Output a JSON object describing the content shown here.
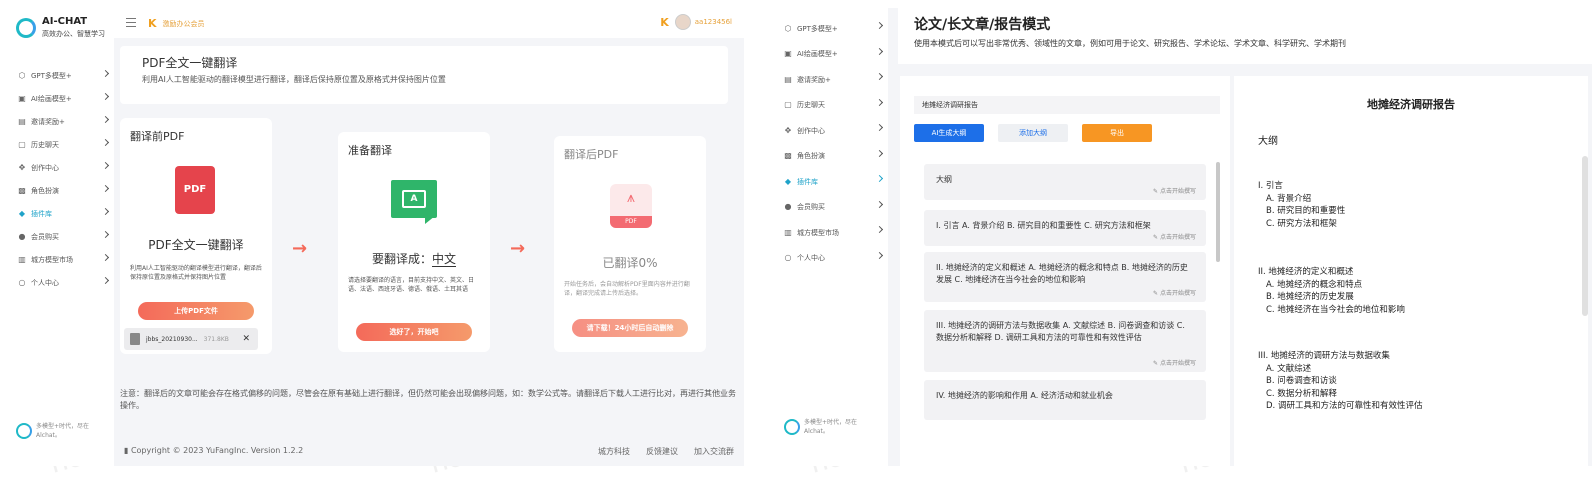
{
  "left_app": {
    "brand": {
      "name": "AI-CHAT",
      "slogan": "高效办公、智慧学习"
    },
    "menu": [
      {
        "icon": "gpt-icon",
        "label": "GPT多模型+"
      },
      {
        "icon": "image-icon",
        "label": "AI绘画模型+"
      },
      {
        "icon": "gift-icon",
        "label": "邀请奖励+"
      },
      {
        "icon": "history-icon",
        "label": "历史聊天"
      },
      {
        "icon": "create-icon",
        "label": "创作中心"
      },
      {
        "icon": "role-icon",
        "label": "角色扮演"
      },
      {
        "icon": "plugin-icon",
        "label": "插件库",
        "active": true
      },
      {
        "icon": "member-icon",
        "label": "会员购买"
      },
      {
        "icon": "market-icon",
        "label": "城方模型市场"
      },
      {
        "icon": "user-icon",
        "label": "个人中心"
      }
    ],
    "sidebar_footer": "多模型+时代，尽在Alchat。",
    "topbar": {
      "vip_text": "激励办公会员",
      "username": "aa123456l"
    },
    "header": {
      "title": "PDF全文一键翻译",
      "subtitle": "利用AI人工智能驱动的翻译模型进行翻译，翻译后保持原位置及原格式并保持图片位置"
    },
    "card_before": {
      "title": "翻译前PDF",
      "icon_text": "PDF",
      "big": "PDF全文一键翻译",
      "desc": "利用AI人工智能驱动的翻译模型进行翻译，翻译后保持原位置及原格式并保持图片位置",
      "button": "上传PDF文件",
      "file_name": "jbbs_20210930...",
      "file_size": "371.8KB"
    },
    "card_ready": {
      "title": "准备翻译",
      "icon_text": "A",
      "big_prefix": "要翻译成：",
      "big_lang": "中文",
      "desc": "请选择要翻译的语言，目前支持中文、英文、日语、法语、西班牙语、德语、俄语、土耳其语",
      "button": "选好了，开始吧"
    },
    "card_after": {
      "title": "翻译后PDF",
      "icon_text": "PDF",
      "big": "已翻译0%",
      "desc": "开始任务后，会自动解析PDF里面内容并进行翻译，翻译完成请上传后选择。",
      "button": "请下载！24小时后自动删除"
    },
    "note": "注意：翻译后的文章可能会存在格式偏移的问题，尽管会在原有基础上进行翻译，但仍然可能会出现偏移问题，如：数学公式等。请翻译后下载人工进行比对，再进行其他业务操作。",
    "footer": {
      "copyright": "Copyright © 2023 YuFangInc. Version 1.2.2",
      "links": [
        "城方科技",
        "反馈建议",
        "加入交流群"
      ]
    }
  },
  "right_app": {
    "menu": [
      {
        "icon": "gpt-icon",
        "label": "GPT多模型+"
      },
      {
        "icon": "image-icon",
        "label": "AI绘画模型+"
      },
      {
        "icon": "gift-icon",
        "label": "邀请奖励+"
      },
      {
        "icon": "history-icon",
        "label": "历史聊天"
      },
      {
        "icon": "create-icon",
        "label": "创作中心"
      },
      {
        "icon": "role-icon",
        "label": "角色扮演"
      },
      {
        "icon": "plugin-icon",
        "label": "插件库",
        "active": true
      },
      {
        "icon": "member-icon",
        "label": "会员购买"
      },
      {
        "icon": "market-icon",
        "label": "城方模型市场"
      },
      {
        "icon": "user-icon",
        "label": "个人中心"
      }
    ],
    "sidebar_footer": "多模型+时代，尽在Alchat。",
    "header": {
      "title": "论文/长文章/报告模式",
      "subtitle": "使用本模式后可以写出非常优秀、领域性的文章，例如可用于论文、研究报告、学术论坛、学术文章、科学研究、学术期刊"
    },
    "topic_value": "地摊经济调研报告",
    "buttons": {
      "generate": "AI生成大纲",
      "add": "添加大纲",
      "export": "导出"
    },
    "write_hint": "点击开始撰写",
    "outline_cards": [
      "大纲",
      "I. 引言 A. 背景介绍 B. 研究目的和重要性 C. 研究方法和框架",
      "II. 地摊经济的定义和概述 A. 地摊经济的概念和特点 B. 地摊经济的历史发展 C. 地摊经济在当今社会的地位和影响",
      "III. 地摊经济的调研方法与数据收集 A. 文献综述 B. 问卷调查和访谈 C. 数据分析和解释 D. 调研工具和方法的可靠性和有效性评估",
      "IV. 地摊经济的影响和作用 A. 经济活动和就业机会"
    ],
    "document": {
      "title": "地摊经济调研报告",
      "outline_label": "大纲",
      "sections": [
        {
          "heading": "I. 引言",
          "items": [
            "A. 背景介绍",
            "B. 研究目的和重要性",
            "C. 研究方法和框架"
          ]
        },
        {
          "heading": "II. 地摊经济的定义和概述",
          "items": [
            "A. 地摊经济的概念和特点",
            "B. 地摊经济的历史发展",
            "C. 地摊经济在当今社会的地位和影响"
          ]
        },
        {
          "heading": "III. 地摊经济的调研方法与数据收集",
          "items": [
            "A. 文献综述",
            "B. 问卷调查和访谈",
            "C. 数据分析和解释",
            "D. 调研工具和方法的可靠性和有效性评估"
          ]
        }
      ]
    }
  },
  "watermark": "nola",
  "colors": {
    "accent_teal": "#1fa3c9",
    "brand_orange": "#f46a5a",
    "primary_blue": "#1d6fe8",
    "export_orange": "#f79623"
  }
}
